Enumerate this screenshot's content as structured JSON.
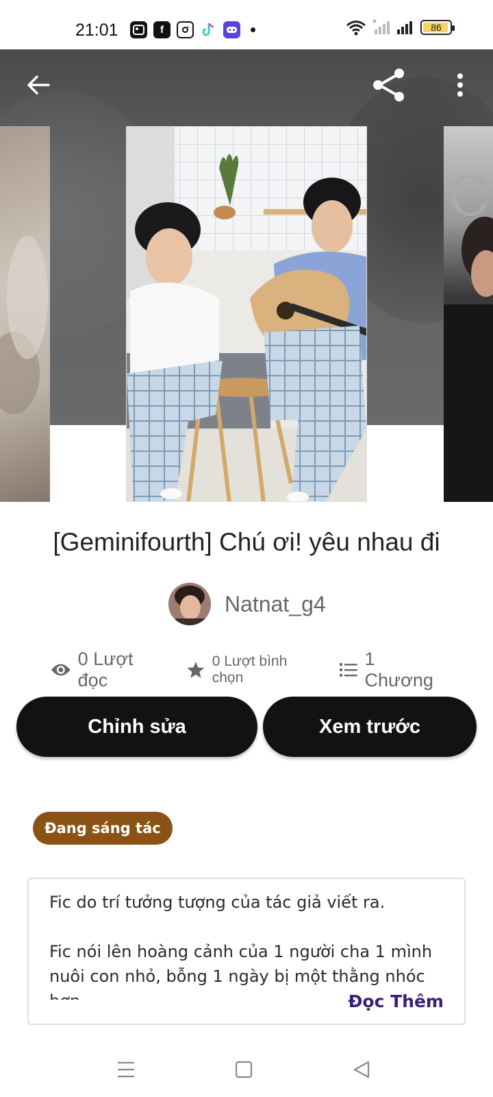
{
  "status_bar": {
    "time": "21:01",
    "battery": "86",
    "apps": [
      "gallery-app-icon",
      "facebook-icon",
      "instagram-icon",
      "tiktok-icon",
      "game-app-icon"
    ]
  },
  "topbar": {
    "back_icon": "arrow-left-icon",
    "share_icon": "share-icon",
    "more_icon": "more-vertical-icon"
  },
  "story": {
    "title": "[Geminifourth] Chú ơi! yêu nhau đi",
    "author": "Natnat_g4",
    "stats": {
      "reads": "0 Lượt đọc",
      "votes": "0 Lượt bình chọn",
      "parts": "1 Chương"
    },
    "status": "Đang sáng tác",
    "description": "Fic do trí tưởng tượng của tác giả viết ra.\n\nFic nói lên hoàng cảnh của 1 người cha 1 mình nuôi con nhỏ, bỗng 1 ngày bị một thằng nhóc hơn",
    "read_more": "Đọc Thêm"
  },
  "actions": {
    "edit": "Chỉnh sửa",
    "preview": "Xem trước"
  },
  "colors": {
    "button_bg": "#121212",
    "badge_bg": "#8a5214",
    "read_more": "#3a1f7a"
  }
}
